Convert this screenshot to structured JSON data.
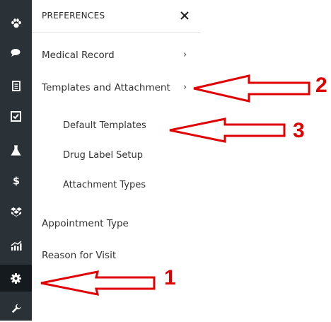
{
  "panel": {
    "title": "PREFERENCES",
    "close_label": "×"
  },
  "menu": {
    "medical_record": "Medical Record",
    "templates_and_attachment": "Templates and Attachment",
    "default_templates": "Default Templates",
    "drug_label_setup": "Drug Label Setup",
    "attachment_types": "Attachment Types",
    "appointment_type": "Appointment Type",
    "reason_for_visit": "Reason for Visit",
    "chevron": "›"
  },
  "rail_icons": [
    "paw-icon",
    "chat-icon",
    "record-icon",
    "checklist-icon",
    "flask-icon",
    "dollar-icon",
    "boxes-icon",
    "chart-icon",
    "gear-icon",
    "wrench-icon"
  ],
  "annotations": {
    "num_1": "1",
    "num_2": "2",
    "num_3": "3"
  },
  "colors": {
    "rail": "#2b3237",
    "rail_active": "#151a1e",
    "annotation": "#e00000"
  }
}
